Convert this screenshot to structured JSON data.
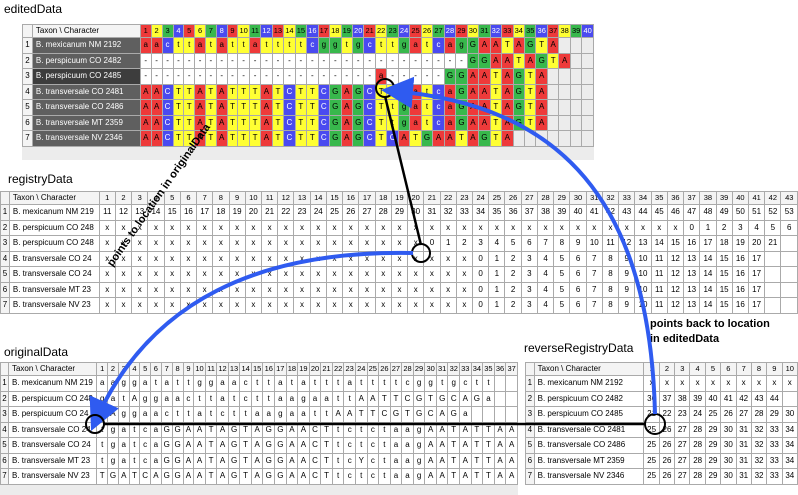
{
  "titles": {
    "edited": "editedData",
    "registry": "registryData",
    "original": "originalData",
    "reverse": "reverseRegistryData"
  },
  "header_label": "Taxon \\ Character",
  "annotations": {
    "points_to": "points to location in originalData",
    "points_back_line1": "points back to location",
    "points_back_line2": "in editedData"
  },
  "edited": {
    "n_cols": 40,
    "col_colors": [
      "#ee3a3a",
      "#ffff33",
      "#38b84c",
      "#4a4af0"
    ],
    "taxa": [
      "B. mexicanum NM 2192",
      "B. perspicuum CO 2482",
      "B. perspicuum CO 2485",
      "B. transversale CO 2481",
      "B. transversale CO 2486",
      "B. transversale MT 2359",
      "B. transversale NV 2346"
    ],
    "rows": [
      "aacttatattattttcggtgcttgatcagGAATAGTA",
      "-----------------------------GGAATAGTA",
      "---------------------a-----GGAATAGTA",
      "AACTTATATTTATCTTCGAGCTtgatcaGAATAGTA",
      "AACTTATATTTATCTTCGAGCTtgatcaGAATAGTA",
      "AACTTATATTTATCTTCGAGCTtgatcaGAATAGTA",
      "AACTTATATTTATCTTCGAGCTCATGAATAGTA"
    ]
  },
  "registry": {
    "n_cols": 43,
    "taxa": [
      "B. mexicanum NM 219",
      "B. perspicuum CO 248",
      "B. perspicuum CO 248",
      "B. transversale CO 24",
      "B. transversale CO 24",
      "B. transversale MT 23",
      "B. transversale NV 23"
    ],
    "rows": [
      [
        "11",
        "12",
        "13",
        "14",
        "15",
        "16",
        "17",
        "18",
        "19",
        "20",
        "21",
        "22",
        "23",
        "24",
        "25",
        "26",
        "27",
        "28",
        "29",
        "30",
        "31",
        "32",
        "33",
        "34",
        "35",
        "36",
        "37",
        "38",
        "39",
        "40",
        "41",
        "42",
        "43",
        "44",
        "45",
        "46",
        "47",
        "48",
        "49",
        "50",
        "51",
        "52",
        "53"
      ],
      [
        "x",
        "x",
        "x",
        "x",
        "x",
        "x",
        "x",
        "x",
        "x",
        "x",
        "x",
        "x",
        "x",
        "x",
        "x",
        "x",
        "x",
        "x",
        "x",
        "x",
        "x",
        "x",
        "x",
        "x",
        "x",
        "x",
        "x",
        "x",
        "x",
        "x",
        "x",
        "x",
        "x",
        "x",
        "x",
        "x",
        "0",
        "1",
        "2",
        "3",
        "4",
        "5",
        "6",
        "7"
      ],
      [
        "x",
        "x",
        "x",
        "x",
        "x",
        "x",
        "x",
        "x",
        "x",
        "x",
        "x",
        "x",
        "x",
        "x",
        "x",
        "x",
        "x",
        "x",
        "x",
        "x",
        "0",
        "1",
        "2",
        "3",
        "4",
        "5",
        "6",
        "7",
        "8",
        "9",
        "10",
        "11",
        "12",
        "13",
        "14",
        "15",
        "16",
        "17",
        "18",
        "19",
        "20",
        "21"
      ],
      [
        "x",
        "x",
        "x",
        "x",
        "x",
        "x",
        "x",
        "x",
        "x",
        "x",
        "x",
        "x",
        "x",
        "x",
        "x",
        "x",
        "x",
        "x",
        "x",
        "x",
        "x",
        "x",
        "x",
        "0",
        "1",
        "2",
        "3",
        "4",
        "5",
        "6",
        "7",
        "8",
        "9",
        "10",
        "11",
        "12",
        "13",
        "14",
        "15",
        "16",
        "17"
      ],
      [
        "x",
        "x",
        "x",
        "x",
        "x",
        "x",
        "x",
        "x",
        "x",
        "x",
        "x",
        "x",
        "x",
        "x",
        "x",
        "x",
        "x",
        "x",
        "x",
        "x",
        "x",
        "x",
        "x",
        "0",
        "1",
        "2",
        "3",
        "4",
        "5",
        "6",
        "7",
        "8",
        "9",
        "10",
        "11",
        "12",
        "13",
        "14",
        "15",
        "16",
        "17"
      ],
      [
        "x",
        "x",
        "x",
        "x",
        "x",
        "x",
        "x",
        "x",
        "x",
        "x",
        "x",
        "x",
        "x",
        "x",
        "x",
        "x",
        "x",
        "x",
        "x",
        "x",
        "x",
        "x",
        "x",
        "0",
        "1",
        "2",
        "3",
        "4",
        "5",
        "6",
        "7",
        "8",
        "9",
        "10",
        "11",
        "12",
        "13",
        "14",
        "15",
        "16",
        "17"
      ],
      [
        "x",
        "x",
        "x",
        "x",
        "x",
        "x",
        "x",
        "x",
        "x",
        "x",
        "x",
        "x",
        "x",
        "x",
        "x",
        "x",
        "x",
        "x",
        "x",
        "x",
        "x",
        "x",
        "x",
        "0",
        "1",
        "2",
        "3",
        "4",
        "5",
        "6",
        "7",
        "8",
        "9",
        "10",
        "11",
        "12",
        "13",
        "14",
        "15",
        "16",
        "17"
      ]
    ]
  },
  "original": {
    "n_cols": 37,
    "taxa": [
      "B. mexicanum NM 219",
      "B. perspicuum CO 248",
      "B. perspicuum CO 24",
      "B. transversale CO 24",
      "B. transversale CO 24",
      "B. transversale MT 23",
      "B. transversale NV 23"
    ],
    "rows": [
      "aaggatattggaacttatatttattttcggtgctt",
      "gatAggaacttatcttaagaattAATTCGTGCAGa",
      "aAggaacttatcttaagaattAATTCGTGCAGa",
      "tgatcaGGAATAGTAGGAACTtctctaagAATATTAA",
      "tgatcaGGAATAGTAGGAACTtctctaagAATATTAA",
      "tgatcaGGAATAGTAGGAACTtcYctaagAATATTAA",
      "TGATCAGGAATAGTAGGAACTtctctaagAATATTAA"
    ]
  },
  "reverse": {
    "col_headers": [
      "1",
      "2",
      "3",
      "4",
      "5",
      "6",
      "7",
      "8",
      "9",
      "10"
    ],
    "taxa": [
      "B. mexicanum NM 2192",
      "B. perspicuum CO 2482",
      "B. perspicuum CO 2485",
      "B. transversale CO 2481",
      "B. transversale CO 2486",
      "B. transversale MT 2359",
      "B. transversale NV 2346"
    ],
    "rows": [
      [
        "x",
        "x",
        "x",
        "x",
        "x",
        "x",
        "x",
        "x",
        "x",
        "x"
      ],
      [
        "36",
        "37",
        "38",
        "39",
        "40",
        "41",
        "42",
        "43",
        "44"
      ],
      [
        "21",
        "22",
        "23",
        "24",
        "25",
        "26",
        "27",
        "28",
        "29",
        "30"
      ],
      [
        "25",
        "26",
        "27",
        "28",
        "29",
        "30",
        "31",
        "32",
        "33",
        "34"
      ],
      [
        "25",
        "26",
        "27",
        "28",
        "29",
        "30",
        "31",
        "32",
        "33",
        "34"
      ],
      [
        "25",
        "26",
        "27",
        "28",
        "29",
        "30",
        "31",
        "32",
        "33",
        "34"
      ],
      [
        "25",
        "26",
        "27",
        "28",
        "29",
        "30",
        "31",
        "32",
        "33",
        "34"
      ]
    ]
  }
}
